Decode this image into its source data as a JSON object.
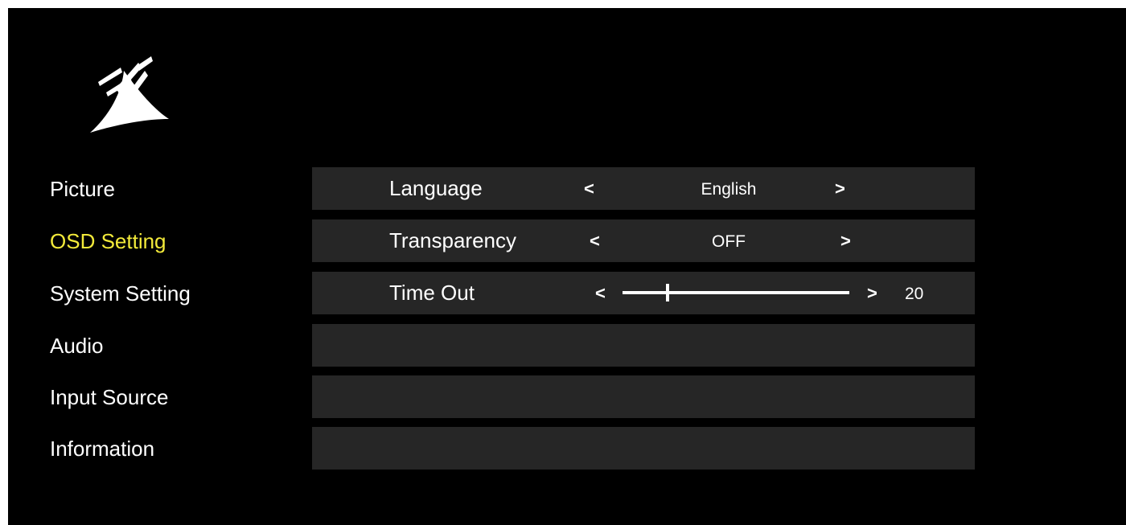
{
  "logo": {
    "icon": "corsair-sails-logo-icon"
  },
  "sidebar": {
    "items": [
      {
        "label": "Picture"
      },
      {
        "label": "OSD Setting",
        "active": true
      },
      {
        "label": "System Setting"
      },
      {
        "label": "Audio"
      },
      {
        "label": "Input Source"
      },
      {
        "label": "Information"
      }
    ],
    "active_color": "#f3ea3a"
  },
  "settings": {
    "rows": [
      {
        "label": "Language",
        "value": "English",
        "prev": "<",
        "next": ">"
      },
      {
        "label": "Transparency",
        "value": "OFF",
        "prev": "<",
        "next": ">"
      },
      {
        "label": "Time Out",
        "prev": "<",
        "next": ">",
        "slider": {
          "value": 20,
          "min": 0,
          "max": 100
        },
        "value_text": "20"
      },
      {
        "label": ""
      },
      {
        "label": ""
      },
      {
        "label": ""
      }
    ]
  }
}
